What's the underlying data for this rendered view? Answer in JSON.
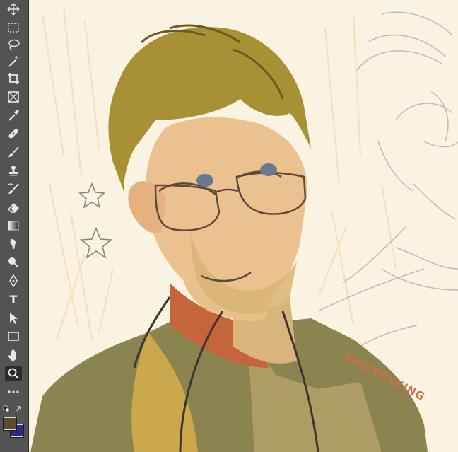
{
  "toolbar": {
    "tools": [
      {
        "name": "move-tool",
        "icon": "move-icon"
      },
      {
        "name": "marquee-tool",
        "icon": "rect-marquee-icon"
      },
      {
        "name": "lasso-tool",
        "icon": "lasso-icon"
      },
      {
        "name": "magic-wand-tool",
        "icon": "magic-wand-icon"
      },
      {
        "name": "crop-tool",
        "icon": "crop-icon"
      },
      {
        "name": "frame-tool",
        "icon": "frame-icon"
      },
      {
        "name": "eyedropper-tool",
        "icon": "eyedropper-icon"
      },
      {
        "name": "healing-brush-tool",
        "icon": "bandage-icon"
      },
      {
        "name": "brush-tool",
        "icon": "brush-icon"
      },
      {
        "name": "clone-stamp-tool",
        "icon": "stamp-icon"
      },
      {
        "name": "history-brush-tool",
        "icon": "history-brush-icon"
      },
      {
        "name": "eraser-tool",
        "icon": "eraser-icon"
      },
      {
        "name": "gradient-tool",
        "icon": "gradient-icon"
      },
      {
        "name": "smudge-tool",
        "icon": "smudge-icon"
      },
      {
        "name": "dodge-tool",
        "icon": "dodge-icon"
      },
      {
        "name": "pen-tool",
        "icon": "pen-icon"
      },
      {
        "name": "type-tool",
        "icon": "type-icon",
        "label": "T"
      },
      {
        "name": "path-selection-tool",
        "icon": "arrow-icon"
      },
      {
        "name": "shape-tool",
        "icon": "rectangle-icon"
      },
      {
        "name": "hand-tool",
        "icon": "hand-icon"
      },
      {
        "name": "zoom-tool",
        "icon": "zoom-icon",
        "active": true
      },
      {
        "name": "more-tools",
        "icon": "ellipsis-icon"
      }
    ],
    "foreground_color": "#5d4a2a",
    "background_color": "#2f2a86"
  },
  "canvas": {
    "background_color": "#fbf3e2",
    "signature_text": "KAIZERXKING"
  }
}
